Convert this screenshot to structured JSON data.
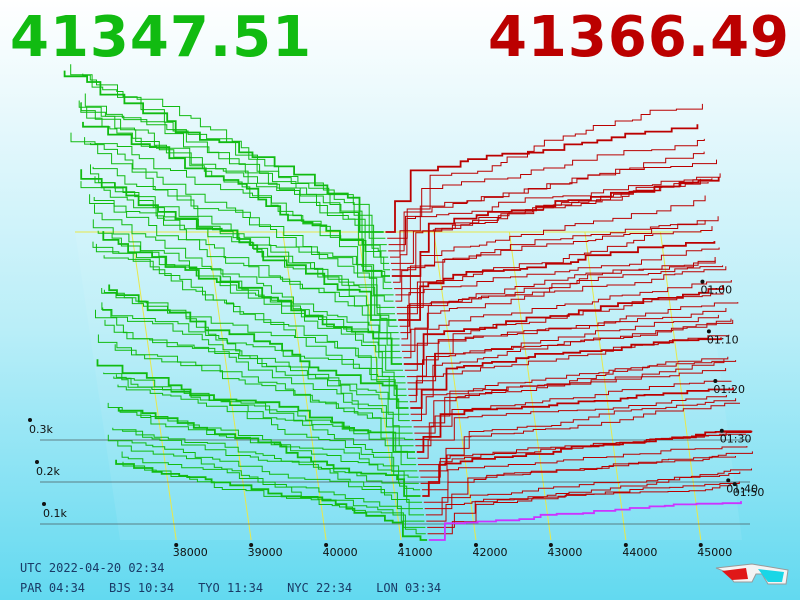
{
  "bid_price": "41347.51",
  "ask_price": "41366.49",
  "colors": {
    "bid": "#11bb11",
    "ask": "#bb0000",
    "accent_line": "#cc33ff",
    "axis": "#e8e84a"
  },
  "clock": {
    "utc": "UTC 2022-04-20 02:34",
    "zones": [
      "PAR 04:34",
      "BJS 10:34",
      "TYO 11:34",
      "NYC 22:34",
      "LON 03:34"
    ]
  },
  "icon": "3d-glasses-icon",
  "chart_data": {
    "type": "area",
    "title": "",
    "x_ticks": [
      "38000",
      "39000",
      "40000",
      "41000",
      "42000",
      "43000",
      "44000",
      "45000"
    ],
    "x_range": [
      37250,
      45550
    ],
    "y_ticks": [
      "0.1k",
      "0.2k",
      "0.3k"
    ],
    "y_range": [
      0,
      350
    ],
    "time_ticks": [
      "01:00",
      "01:10",
      "01:20",
      "01:30",
      "01:40",
      "01:50"
    ],
    "bid_price": 41347.51,
    "ask_price": 41366.49,
    "snapshot_count": 50,
    "grid": true
  }
}
